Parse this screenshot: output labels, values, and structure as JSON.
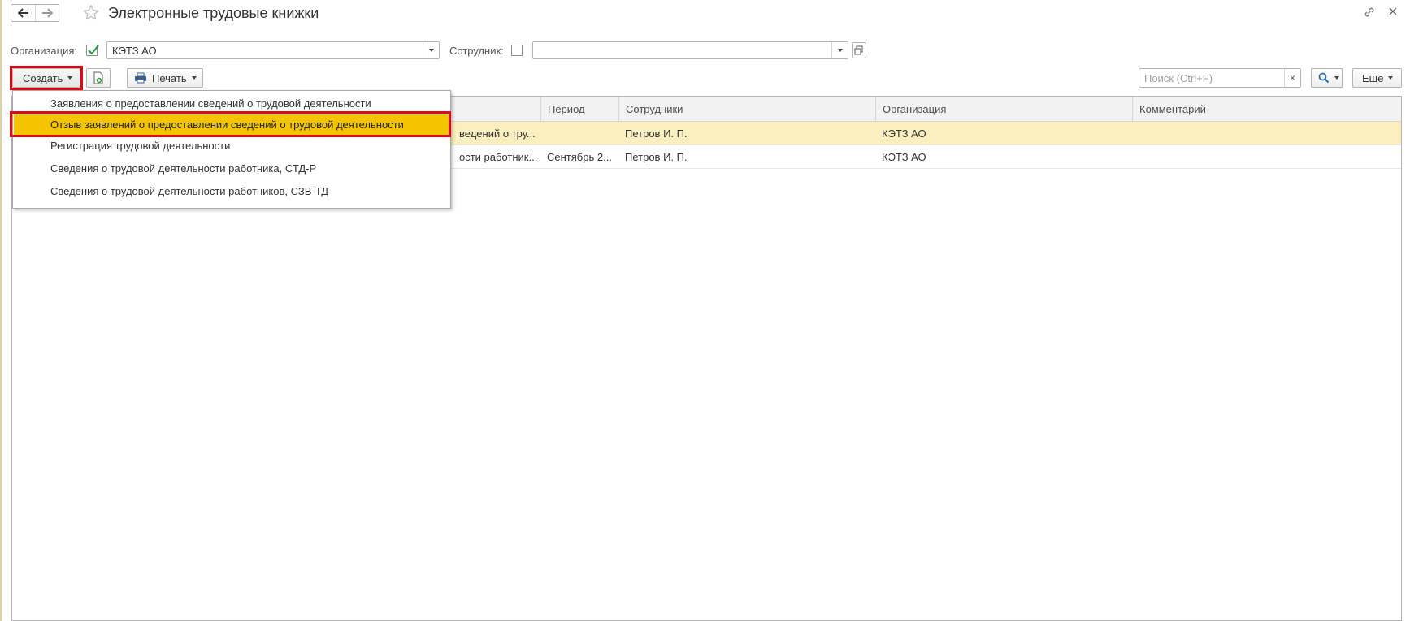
{
  "window": {
    "title": "Электронные трудовые книжки",
    "icons": {
      "back": "arrow-left-icon",
      "forward": "arrow-right-icon",
      "favorite": "star-icon",
      "link": "link-icon",
      "close": "close-icon"
    }
  },
  "filters": {
    "organization_label": "Организация:",
    "organization_checked": true,
    "organization_value": "КЭТЗ АО",
    "employee_label": "Сотрудник:",
    "employee_checked": false,
    "employee_value": ""
  },
  "toolbar": {
    "create_label": "Создать",
    "print_label": "Печать",
    "search_placeholder": "Поиск (Ctrl+F)",
    "search_clear": "×",
    "more_label": "Еще"
  },
  "table": {
    "columns": [
      "Период",
      "Сотрудники",
      "Организация",
      "Комментарий"
    ],
    "rows": [
      {
        "document": "ведений о тру...",
        "period": "",
        "employees": "Петров И. П.",
        "organization": "КЭТЗ АО",
        "comment": ""
      },
      {
        "document": "ости работник...",
        "period": "Сентябрь 2...",
        "employees": "Петров И. П.",
        "organization": "КЭТЗ АО",
        "comment": ""
      }
    ],
    "selected_row": 0
  },
  "create_menu": {
    "items": [
      "Заявления о предоставлении сведений о трудовой деятельности",
      "Отзыв заявлений о предоставлении сведений о трудовой деятельности",
      "Регистрация трудовой деятельности",
      "Сведения о трудовой деятельности работника, СТД-Р",
      "Сведения о трудовой деятельности работников, СЗВ-ТД"
    ],
    "highlighted_index": 1
  },
  "colors": {
    "highlight": "#f5c400",
    "selected_row": "#fcefbf",
    "annotation": "#e30613",
    "check": "#1e9c3a"
  }
}
